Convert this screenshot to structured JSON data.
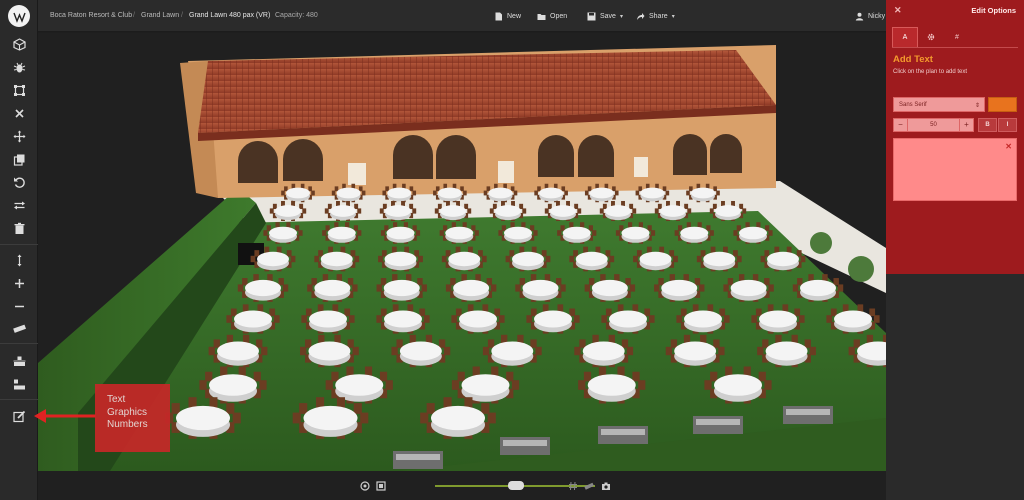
{
  "header": {
    "breadcrumbs": [
      "Boca Raton Resort & Club",
      "Grand Lawn",
      "Grand Lawn 480 pax (VR)"
    ],
    "capacity": "Capacity: 480",
    "actions": {
      "new": "New",
      "open": "Open",
      "save": "Save",
      "share": "Share"
    },
    "user": "Nicky"
  },
  "callout": {
    "lines": [
      "Text",
      "Graphics",
      "Numbers"
    ]
  },
  "edit_panel": {
    "title": "Edit Options",
    "tabs": [
      "A",
      "gear-icon",
      "#"
    ],
    "section_title": "Add Text",
    "hint": "Click on the plan to add text",
    "font": "Sans Serif",
    "size": "50",
    "style_buttons": [
      "B",
      "I"
    ],
    "swatch_color": "#e8731e"
  },
  "colors": {
    "panel": "#9e1b1e",
    "accent": "#f39a2d",
    "callout": "#c62828",
    "zoom_track": "#7f9a2e"
  },
  "icons": {
    "left_toolbar": [
      "cube-icon",
      "bug-icon",
      "crop-icon",
      "close-icon",
      "move-icon",
      "copy-icon",
      "undo-icon",
      "swap-icon",
      "trash-icon",
      "height-icon",
      "plus-icon",
      "minus-icon",
      "ruler-icon",
      "align-center-icon",
      "align-left-icon",
      "edit-icon"
    ],
    "bottom_bar": [
      "target-icon",
      "fit-icon",
      "hash-icon",
      "ruler-icon",
      "camera-icon"
    ]
  }
}
